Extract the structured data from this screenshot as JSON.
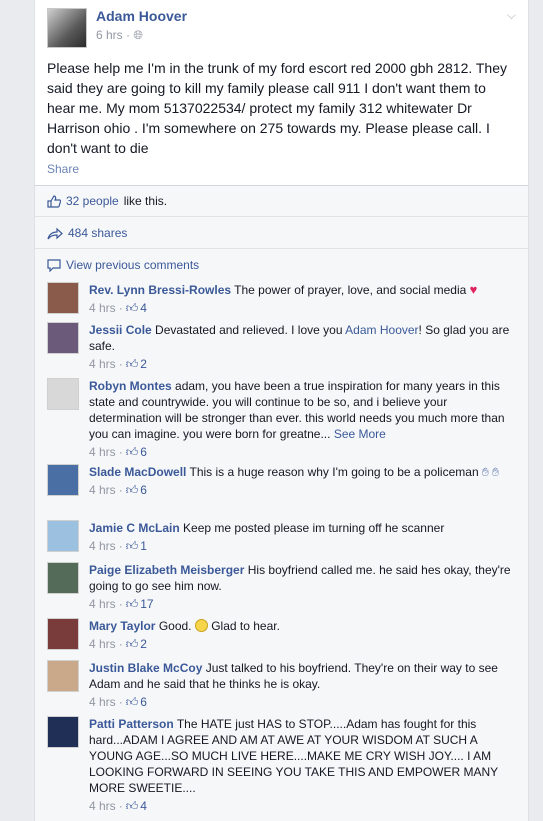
{
  "post": {
    "author": "Adam Hoover",
    "time": "6 hrs",
    "audience_icon": "globe-icon",
    "text": "Please help me I'm in the trunk of my ford escort red 2000 gbh 2812. They said they are going to kill my family please call 911 I don't want them to hear me. My mom 5137022534/ protect my family 312 whitewater Dr Harrison ohio . I'm somewhere on 275 towards my. Please please call. I don't want to die",
    "share": "Share"
  },
  "ufi": {
    "likes_link": "32 people",
    "likes_suffix": "like this.",
    "shares": "484 shares",
    "view_previous": "View previous comments"
  },
  "comments": [
    {
      "name": "Rev. Lynn Bressi-Rowles",
      "text": "The power of prayer, love, and social media",
      "time": "4 hrs",
      "likes": "4",
      "avatar_color": "#8a5a4a"
    },
    {
      "name": "Jessii Cole",
      "text_a": "Devastated and relieved. I love you",
      "link": "Adam Hoover",
      "text_b": "! So glad you are safe.",
      "time": "4 hrs",
      "likes": "2",
      "avatar_color": "#6b5a7a"
    },
    {
      "name": "Robyn Montes",
      "text": "adam, you have been a true inspiration for many years in this state and countrywide. you will continue to be so, and i believe your determination will be stronger than ever. this world needs you much more than you can imagine. you were born for greatne...",
      "see_more": "See More",
      "time": "4 hrs",
      "likes": "6",
      "avatar_color": "#d8d8d8"
    },
    {
      "name": "Slade MacDowell",
      "text": "This is a huge reason why I'm going to be a policeman",
      "time": "4 hrs",
      "likes": "6",
      "avatar_color": "#4a6fa5"
    },
    {
      "name": "Jamie C McLain",
      "text": "Keep me posted please im turning off he scanner",
      "time": "4 hrs",
      "likes": "1",
      "avatar_color": "#9cc0e0"
    },
    {
      "name": "Paige Elizabeth Meisberger",
      "text": "His boyfriend called me. he said hes okay, they're going to go see him now.",
      "time": "4 hrs",
      "likes": "17",
      "avatar_color": "#556b5a"
    },
    {
      "name": "Mary Taylor",
      "text_a": "Good.",
      "text_b": "Glad to hear.",
      "time": "4 hrs",
      "likes": "2",
      "avatar_color": "#7a3b3b"
    },
    {
      "name": "Justin Blake McCoy",
      "text": "Just talked to his boyfriend. They're on their way to see Adam and he said that he thinks he is okay.",
      "time": "4 hrs",
      "likes": "6",
      "avatar_color": "#c9a98a"
    },
    {
      "name": "Patti Patterson",
      "text": "The HATE just HAS to STOP.....Adam has fought for this hard...ADAM I AGREE AND AM AT AWE AT YOUR WISDOM AT SUCH A YOUNG AGE...SO MUCH LIVE HERE....MAKE ME CRY WISH JOY.... I AM LOOKING FORWARD IN SEEING YOU TAKE THIS AND EMPOWER MANY MORE SWEETIE....",
      "time": "4 hrs",
      "likes": "4",
      "avatar_color": "#1f2f55"
    }
  ],
  "colors": {
    "link": "#3b5998",
    "meta": "#9197a3",
    "heart": "#e0245e"
  }
}
